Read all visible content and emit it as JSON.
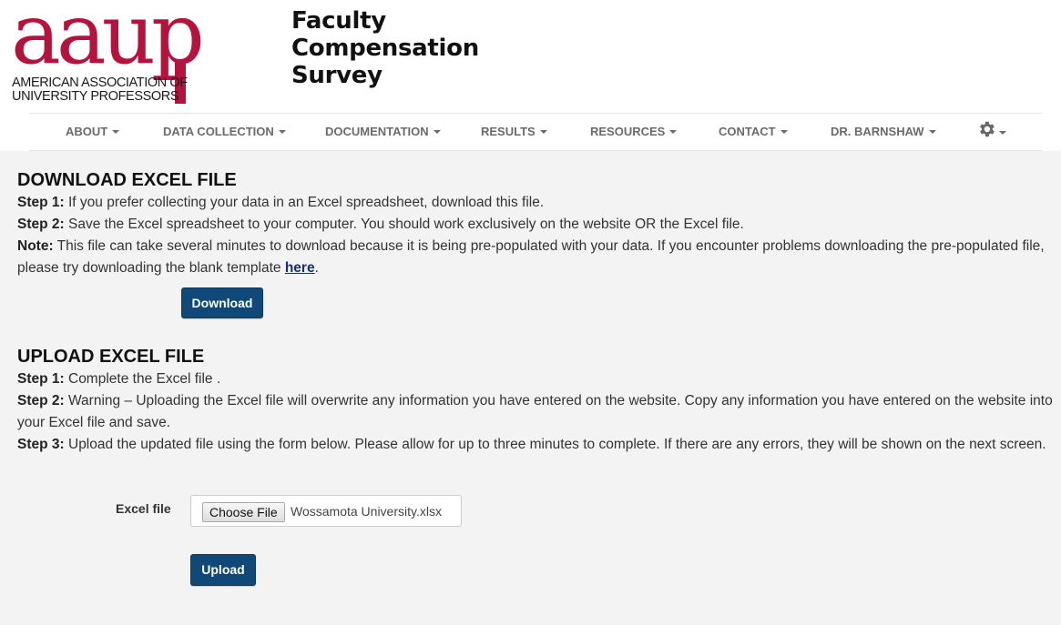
{
  "logo": {
    "word": "aaup",
    "line1": "American Association of",
    "line2": "University Professors"
  },
  "site_title": {
    "line1": "Faculty",
    "line2": "Compensation",
    "line3": "Survey"
  },
  "nav": {
    "items": [
      "ABOUT",
      "DATA COLLECTION",
      "DOCUMENTATION",
      "RESULTS",
      "RESOURCES",
      "CONTACT",
      "DR. BARNSHAW"
    ],
    "settings_icon": "gear-icon"
  },
  "download": {
    "heading": "DOWNLOAD EXCEL FILE",
    "step1_label": "Step 1:",
    "step1_text": " If you prefer collecting your data in an Excel spreadsheet, download this file.",
    "step2_label": "Step 2:",
    "step2_text": " Save the Excel spreadsheet to your computer. You should work exclusively on the website OR the Excel file.",
    "note_label": "Note:",
    "note_text": " This file can take several minutes to download because it is being pre-populated with your data. If you encounter problems downloading the pre-populated file, please try downloading the blank template ",
    "note_link": "here",
    "note_end": ".",
    "button": "Download"
  },
  "upload": {
    "heading": "UPLOAD EXCEL FILE",
    "step1_label": "Step 1:",
    "step1_text": " Complete the Excel file .",
    "step2_label": "Step 2:",
    "step2_text": " Warning – Uploading the Excel file will overwrite any information you have entered on the website. Copy any information you have entered on the website into your Excel file and save.",
    "step3_label": "Step 3:",
    "step3_text": " Upload the updated file using the form below. Please allow for up to three minutes to complete. If there are any errors, they will be shown on the next screen.",
    "field_label": "Excel file",
    "choose_button": "Choose File",
    "file_name": "Wossamota University.xlsx",
    "button": "Upload"
  },
  "colors": {
    "brand": "#b5123e",
    "button": "#104878",
    "background": "#f3f3f3"
  }
}
